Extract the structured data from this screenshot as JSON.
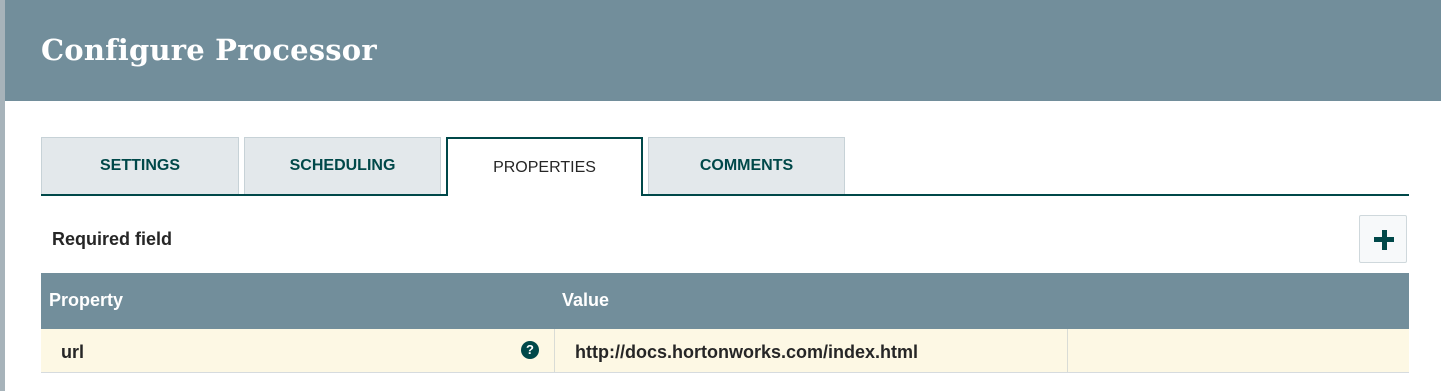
{
  "dialog": {
    "title": "Configure Processor"
  },
  "tabs": [
    {
      "label": "SETTINGS",
      "active": false
    },
    {
      "label": "SCHEDULING",
      "active": false
    },
    {
      "label": "PROPERTIES",
      "active": true
    },
    {
      "label": "COMMENTS",
      "active": false
    }
  ],
  "properties": {
    "required_label": "Required field",
    "add_icon": "plus-icon",
    "columns": [
      "Property",
      "Value"
    ],
    "rows": [
      {
        "property": "url",
        "help_icon": "question-circle-icon",
        "help_glyph": "?",
        "value": "http://docs.hortonworks.com/index.html",
        "extra": ""
      }
    ]
  },
  "colors": {
    "header_bg": "#728e9b",
    "accent": "#004849",
    "row_bg": "#fdf8e4",
    "tab_bg": "#e3e8eb"
  }
}
